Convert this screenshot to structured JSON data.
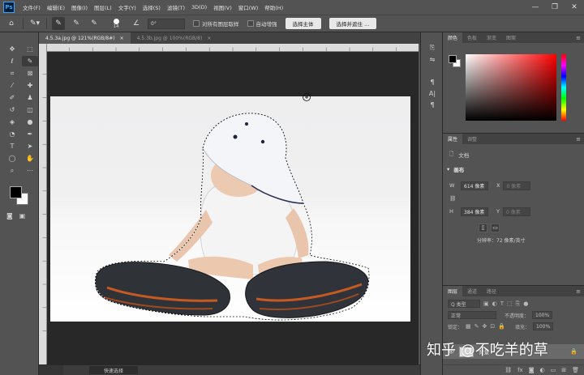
{
  "app": {
    "logo": "Ps",
    "menu": [
      "文件(F)",
      "编辑(E)",
      "图像(I)",
      "图层(L)",
      "文字(Y)",
      "选择(S)",
      "滤镜(T)",
      "3D(D)",
      "视图(V)",
      "窗口(W)",
      "帮助(H)"
    ],
    "window_controls": [
      "—",
      "❐",
      "✕"
    ]
  },
  "options": {
    "brush_size": "14",
    "angle": "0°",
    "sample_all_layers": "对所有图层取样",
    "auto_enhance": "自动增强",
    "select_subject": "选择主体",
    "select_and_mask": "选择并遮住 ..."
  },
  "document": {
    "tabs": [
      {
        "label": "4.5.3a.jpg @ 121%(RGB/8#)",
        "close": "×",
        "active": true
      },
      {
        "label": "4.5.3b.jpg @ 100%(RGB/8)",
        "close": "×",
        "active": false
      }
    ],
    "status_tool": "快速选择"
  },
  "color_panel": {
    "tabs": [
      "颜色",
      "色板",
      "渐变",
      "图案"
    ],
    "foreground": "#000000",
    "background": "#ffffff"
  },
  "properties_panel": {
    "tabs": [
      "属性",
      "调整"
    ],
    "doc_label": "文档",
    "canvas_heading": "画布",
    "width_label": "W",
    "width_value": "614 像素",
    "height_label": "H",
    "height_value": "384 像素",
    "x_label": "X",
    "x_placeholder": "0 像素",
    "y_label": "Y",
    "y_placeholder": "0 像素",
    "resolution": "分辨率：72 像素/英寸"
  },
  "layers_panel": {
    "tabs": [
      "图层",
      "通道",
      "路径"
    ],
    "kind_filter": "Q 类型",
    "blend_mode": "正常",
    "opacity_label": "不透明度：",
    "opacity_value": "100%",
    "lock_label": "锁定：",
    "fill_label": "填充：",
    "fill_value": "100%",
    "layer_name": "背景"
  },
  "watermark": "知乎 @不吃羊的草"
}
